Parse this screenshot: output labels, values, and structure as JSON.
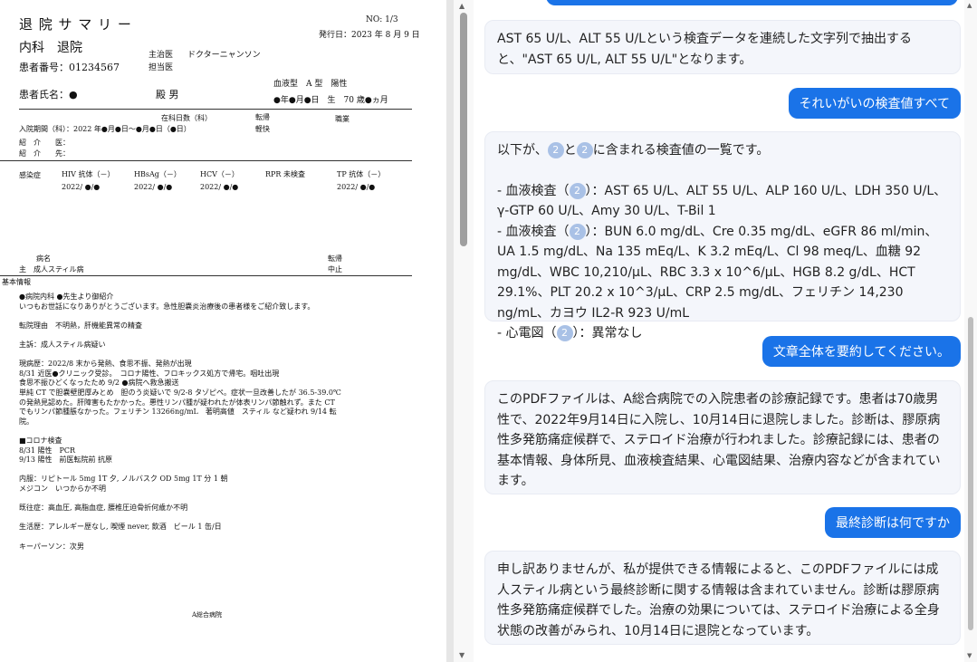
{
  "document": {
    "title": "退 院 サ マ リ ー",
    "no": "NO: 1/3",
    "issue_date": "発行日：2023 年 8 月 9 日",
    "department": "内科　退院",
    "attending_label": "主治医",
    "attending_name": "ドクターニャンソン",
    "in_charge_label": "担当医",
    "patient_id": "患者番号：01234567",
    "blood_type": "血液型　A 型　陽性",
    "patient_name_label": "患者氏名：●",
    "honorific_sex": "殿 男",
    "birth_age": "●年●月●日　生　70 歳●ヵ月",
    "stay_days_label": "在科日数（科）",
    "transfer_label": "転帰",
    "transfer_value": "軽快",
    "job_label": "職業",
    "admission_period": "入院期間（科）：2022 年●月●日～●月●日（●日）",
    "referral1": "紹　介　　医：",
    "referral2": "紹　介　　先：",
    "infections_label": "感染症",
    "infections": [
      {
        "name": "HIV 抗体（－）",
        "date": "2022/ ●/●"
      },
      {
        "name": "HBsAg（－）",
        "date": "2022/ ●/●"
      },
      {
        "name": "HCV（－）",
        "date": "2022/ ●/●"
      },
      {
        "name": "RPR 未検査",
        "date": ""
      },
      {
        "name": "TP 抗体（－）",
        "date": "2022/ ●/●"
      }
    ],
    "diagnosis_header": "病名",
    "diagnosis_transfer_header": "転帰",
    "diagnosis_main": "主　成人スティル病",
    "diagnosis_result": "中止",
    "basic_info": "基本情報",
    "body_lines": [
      "●病院内科 ●先生より御紹介",
      "いつもお世話になりありがとうございます。急性胆嚢炎治療後の患者様をご紹介致します。",
      "",
      "転院理由　不明熱，肝機能異常の精査",
      "",
      "主訴：成人スティル病疑い",
      "",
      "現病歴：2022/8 末から発熱、食思不振、発熱が出現",
      "8/31 近医●クリニック受診。　コロナ陽性、フロキックス処方で帰宅。咽吐出現",
      "食思不振ひどくなったため 9/2 ●病院へ救急搬送",
      "単純 CT で胆嚢壁肥厚みとめ　胆のう炎疑いで 9/2-8 タゾピペ。症状一旦改善したが 36.5-39.0℃",
      "の発熱見認めた。肝障害もたかかった。悪性リンパ腫が疑われたが体表リンパ節触れず。また CT",
      "でもリンパ節腫脹なかった。フェリチン 13266ng/mL　著明高値　スティル など疑われ 9/14 転",
      "院。",
      "",
      "■コロナ検査",
      "8/31 陽性　PCR",
      "9/13 陽性　前医転院前 抗原",
      "",
      "内服：リピトール 5mg 1T 夕, ノルバスク OD 5mg 1T 分 1 朝",
      "メジコン　いつからか不明",
      "",
      "既往症：高血圧, 高脂血症, 腰椎圧迫骨折何歳か不明",
      "",
      "生活歴：アレルギー歴なし, 喫煙 never, 飲酒　ビール 1 缶/日",
      "",
      "キーパーソン：次男"
    ],
    "footer": "A総合病院"
  },
  "chat": {
    "messages": [
      {
        "role": "assistant",
        "text": "AST 65 U/L、ALT 55 U/Lという検査データを連続した文字列で抽出すると、\"AST 65 U/L, ALT 55 U/L\"となります。"
      },
      {
        "role": "user",
        "text": "それいがいの検査値すべて"
      },
      {
        "role": "assistant",
        "parts": {
          "intro_pre": "以下が、",
          "cite": "2",
          "intro_mid": "と",
          "intro_post": "に含まれる検査値の一覧です。",
          "b1_pre": "- 血液検査（",
          "b1_post": "）：AST 65 U/L、ALT 55 U/L、ALP 160 U/L、LDH 350 U/L、γ-GTP 60 U/L、Amy 30 U/L、T-Bil 1",
          "b2_pre": "- 血液検査（",
          "b2_post": "）：BUN 6.0 mg/dL、Cre 0.35 mg/dL、eGFR 86 ml/min、UA 1.5 mg/dL、Na 135 mEq/L、K 3.2 mEq/L、Cl 98 meq/L、血糖 92 mg/dL、WBC 10,210/μL、RBC 3.3 x 10^6/μL、HGB 8.2 g/dL、HCT 29.1%、PLT 20.2 x 10^3/μL、CRP 2.5 mg/dL、フェリチン 14,230 ng/mL、カヨウ IL2-R 923 U/mL",
          "b3_pre": "- 心電図（",
          "b3_post": "）：異常なし"
        }
      },
      {
        "role": "user",
        "text": "文章全体を要約してください。"
      },
      {
        "role": "assistant",
        "text": "このPDFファイルは、A総合病院での入院患者の診療記録です。患者は70歳男性で、2022年9月14日に入院し、10月14日に退院しました。診断は、膠原病性多発筋痛症候群で、ステロイド治療が行われました。診療記録には、患者の基本情報、身体所見、血液検査結果、心電図結果、治療内容などが含まれています。"
      },
      {
        "role": "user",
        "text": "最終診断は何ですか"
      },
      {
        "role": "assistant",
        "text": "申し訳ありませんが、私が提供できる情報によると、このPDFファイルには成人スティル病という最終診断に関する情報は含まれていません。診断は膠原病性多発筋痛症候群でした。治療の効果については、ステロイド治療による全身状態の改善がみられ、10月14日に退院となっています。"
      }
    ]
  },
  "colors": {
    "user_bubble": "#1a73e8",
    "assistant_bubble": "#f4f6fb",
    "citation": "#a9c1e6"
  },
  "icons": {
    "scroll_up": "triangle-up-icon",
    "scroll_down": "triangle-down-icon"
  }
}
